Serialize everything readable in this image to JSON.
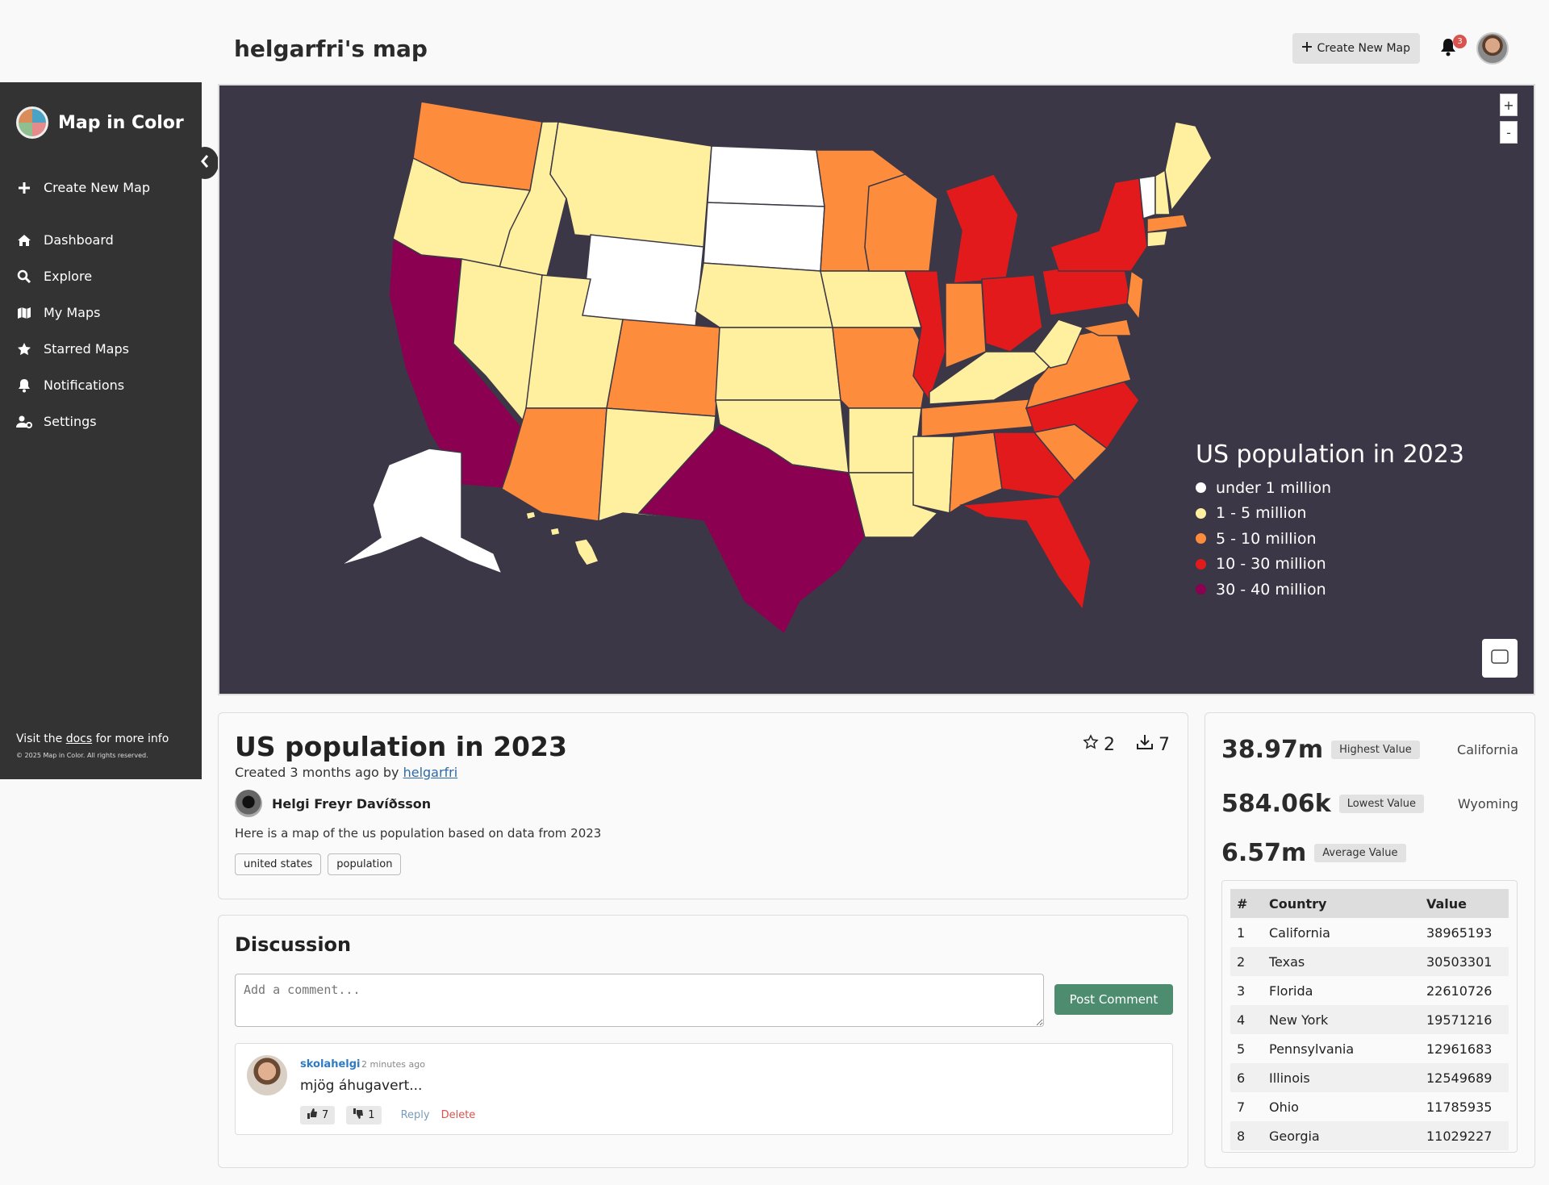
{
  "header": {
    "title": "helgarfri's map",
    "create_label": "Create New Map",
    "notification_count": "3"
  },
  "sidebar": {
    "brand": "Map in Color",
    "items": [
      {
        "label": "Create New Map",
        "icon": "plus-icon"
      },
      {
        "label": "Dashboard",
        "icon": "home-icon"
      },
      {
        "label": "Explore",
        "icon": "search-icon"
      },
      {
        "label": "My Maps",
        "icon": "map-icon"
      },
      {
        "label": "Starred Maps",
        "icon": "star-icon"
      },
      {
        "label": "Notifications",
        "icon": "bell-icon"
      },
      {
        "label": "Settings",
        "icon": "user-gear-icon"
      }
    ],
    "footer_prefix": "Visit the",
    "footer_link": "docs",
    "footer_suffix": "for more info",
    "copyright": "© 2025 Map in Color. All rights reserved."
  },
  "map": {
    "background": "#3c3746",
    "zoom_in": "+",
    "zoom_out": "-",
    "legend_title": "US population in 2023",
    "legend": [
      {
        "label": "under 1 million",
        "color": "#ffffff"
      },
      {
        "label": "1 - 5 million",
        "color": "#fff0a0"
      },
      {
        "label": "5 - 10 million",
        "color": "#fd8d3c"
      },
      {
        "label": "10 - 30 million",
        "color": "#e31a1c"
      },
      {
        "label": "30 - 40 million",
        "color": "#8b0050"
      }
    ]
  },
  "info": {
    "title": "US population in 2023",
    "created_prefix": "Created 3 months ago by",
    "created_user": "helgarfri",
    "author_name": "Helgi Freyr Davíðsson",
    "description": "Here is a map of the us population based on data from 2023",
    "tags": [
      "united states",
      "population"
    ],
    "stars": "2",
    "downloads": "7"
  },
  "discussion": {
    "title": "Discussion",
    "placeholder": "Add a comment...",
    "post_label": "Post Comment",
    "comment": {
      "user": "skolahelgi",
      "time": "2 minutes ago",
      "text": "mjög áhugavert...",
      "likes": "7",
      "dislikes": "1",
      "reply": "Reply",
      "delete": "Delete"
    }
  },
  "stats": {
    "highest": {
      "value": "38.97m",
      "label": "Highest Value",
      "place": "California"
    },
    "lowest": {
      "value": "584.06k",
      "label": "Lowest Value",
      "place": "Wyoming"
    },
    "average": {
      "value": "6.57m",
      "label": "Average Value"
    },
    "table_headers": [
      "#",
      "Country",
      "Value"
    ],
    "rows": [
      [
        "1",
        "California",
        "38965193"
      ],
      [
        "2",
        "Texas",
        "30503301"
      ],
      [
        "3",
        "Florida",
        "22610726"
      ],
      [
        "4",
        "New York",
        "19571216"
      ],
      [
        "5",
        "Pennsylvania",
        "12961683"
      ],
      [
        "6",
        "Illinois",
        "12549689"
      ],
      [
        "7",
        "Ohio",
        "11785935"
      ],
      [
        "8",
        "Georgia",
        "11029227"
      ]
    ]
  }
}
